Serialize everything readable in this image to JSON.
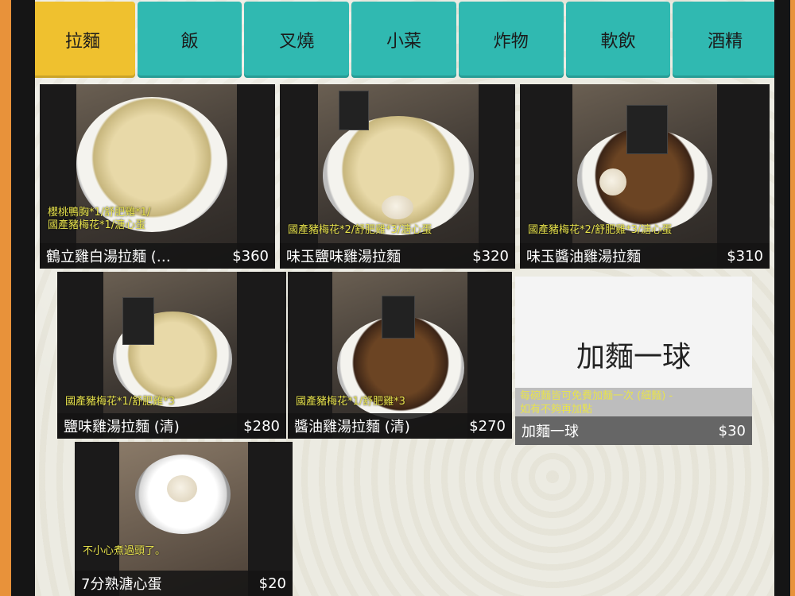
{
  "tabs": [
    "拉麵",
    "飯",
    "叉燒",
    "小菜",
    "炸物",
    "軟飲",
    "酒精"
  ],
  "active_tab": "拉麵",
  "items": [
    {
      "name": "鶴立雞白湯拉麵 (…",
      "price": "$360",
      "desc_line1": "櫻桃鴨胸*1/舒肥雞*1/",
      "desc_line2": "國產豬梅花*1/溏心蛋"
    },
    {
      "name": "味玉鹽味雞湯拉麵",
      "price": "$320",
      "desc_line1": "國產豬梅花*2/舒肥雞*3/溏心蛋",
      "desc_line2": ""
    },
    {
      "name": "味玉醬油雞湯拉麵",
      "price": "$310",
      "desc_line1": "國產豬梅花*2/舒肥雞*3/溏心蛋",
      "desc_line2": ""
    },
    {
      "name": "鹽味雞湯拉麵 (清)",
      "price": "$280",
      "desc_line1": "國產豬梅花*1/舒肥雞*3",
      "desc_line2": ""
    },
    {
      "name": "醬油雞湯拉麵 (清)",
      "price": "$270",
      "desc_line1": "國產豬梅花*1/舒肥雞*3",
      "desc_line2": ""
    },
    {
      "name": "加麵一球",
      "price": "$30",
      "big_text": "加麵一球",
      "desc_line1": "每碗麵皆可免費加麵一次 (細麵) -",
      "desc_line2": "如有不夠再加點"
    },
    {
      "name": "7分熟溏心蛋",
      "price": "$20",
      "desc_line1": "不小心煮過頭了。",
      "desc_line2": ""
    }
  ],
  "colors": {
    "tab": "#30b9b1",
    "tab_active": "#efc12f",
    "desc_text": "#e8e34d"
  }
}
